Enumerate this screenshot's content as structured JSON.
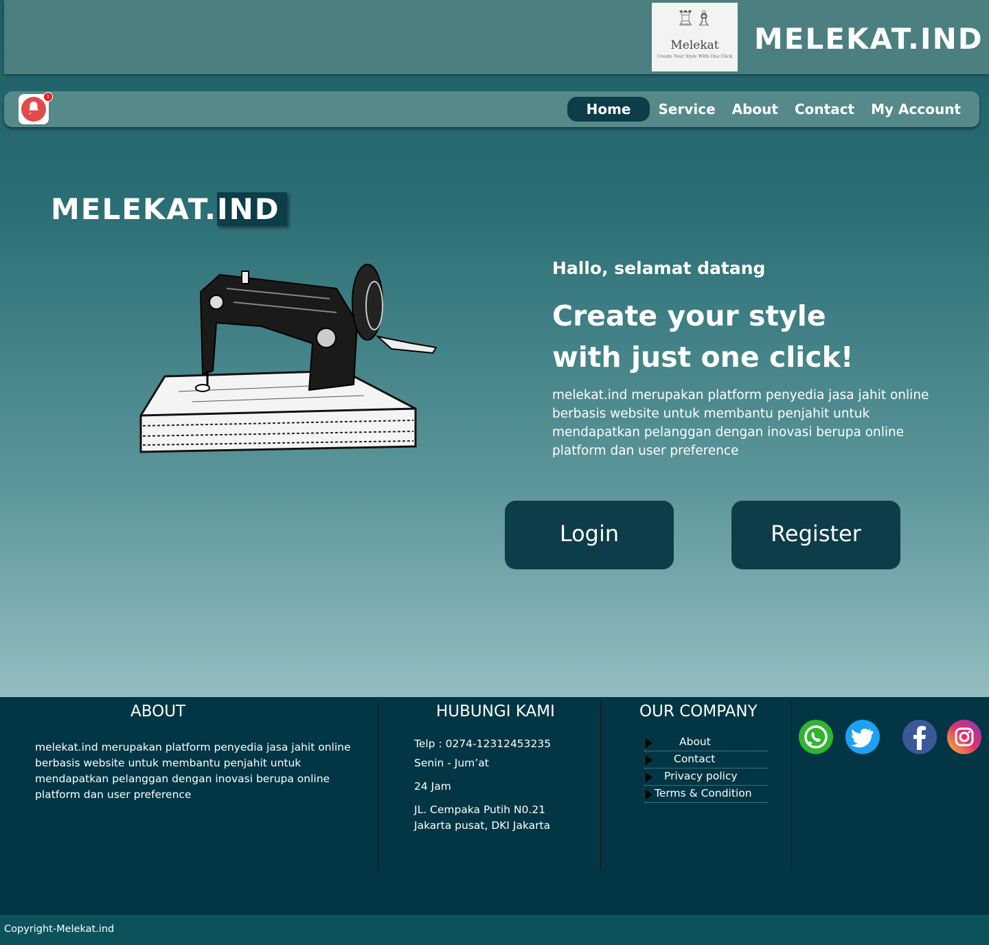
{
  "header": {
    "logo": {
      "name": "Melekat",
      "tagline": "Create Your Style With One Click"
    },
    "brand": "MELEKAT.IND"
  },
  "nav": {
    "notification_count": "1",
    "items": [
      {
        "label": "Home",
        "active": true
      },
      {
        "label": "Service"
      },
      {
        "label": "About"
      },
      {
        "label": "Contact"
      },
      {
        "label": "My Account"
      }
    ]
  },
  "hero": {
    "brand_part1": "MELEKAT.",
    "brand_part2": "IND",
    "greeting": "Hallo, selamat datang",
    "headline_line1": "Create your style",
    "headline_line2": "with just one click!",
    "description": "melekat.ind merupakan platform penyedia jasa jahit online berbasis website untuk membantu penjahit untuk mendapatkan pelanggan dengan inovasi berupa online platform dan user preference",
    "login_label": "Login",
    "register_label": "Register"
  },
  "footer": {
    "about_title": "ABOUT",
    "about_text": "melekat.ind merupakan platform penyedia jasa jahit online berbasis website untuk membantu penjahit untuk mendapatkan pelanggan dengan inovasi berupa online platform dan user preference",
    "contact_title": "HUBUNGI KAMI",
    "phone": "Telp  :  0274-12312453235",
    "days": "Senin - Jum’at",
    "hours": "24 Jam",
    "address_line1": "JL. Cempaka Putih N0.21",
    "address_line2": "Jakarta pusat, DKI Jakarta",
    "company_title": "OUR COMPANY",
    "company_links": [
      "About",
      "Contact",
      "Privacy policy",
      "Terms & Condition"
    ],
    "social": [
      "whatsapp-icon",
      "twitter-icon",
      "facebook-icon",
      "instagram-icon"
    ]
  },
  "copyright": "Copyright-Melekat.ind",
  "colors": {
    "dark_teal": "#0c3d48",
    "footer_bg": "#023644",
    "header_bg": "#4b7f80"
  }
}
